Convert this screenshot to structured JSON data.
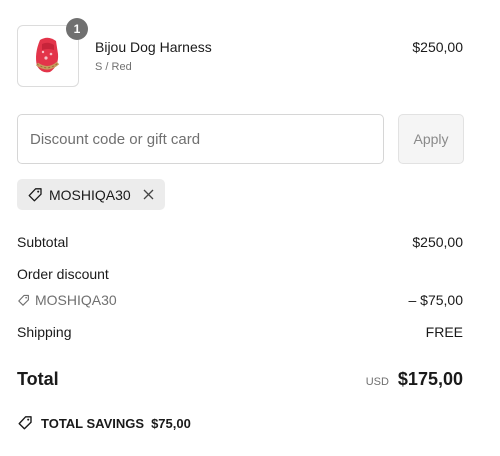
{
  "product": {
    "quantity": "1",
    "name": "Bijou Dog Harness",
    "variant": "S / Red",
    "price": "$250,00",
    "image_icon": "dog-harness-icon"
  },
  "discount": {
    "placeholder": "Discount code or gift card",
    "apply_label": "Apply",
    "applied_code": "MOSHIQA30"
  },
  "summary": {
    "subtotal_label": "Subtotal",
    "subtotal_value": "$250,00",
    "order_discount_label": "Order discount",
    "discount_code": "MOSHIQA30",
    "discount_value": "– $75,00",
    "shipping_label": "Shipping",
    "shipping_value": "FREE",
    "total_label": "Total",
    "currency": "USD",
    "total_value": "$175,00",
    "savings_label": "TOTAL SAVINGS",
    "savings_value": "$75,00"
  },
  "colors": {
    "product": "#e3344a",
    "muted_text": "#707070",
    "chip_bg": "#ececec"
  }
}
